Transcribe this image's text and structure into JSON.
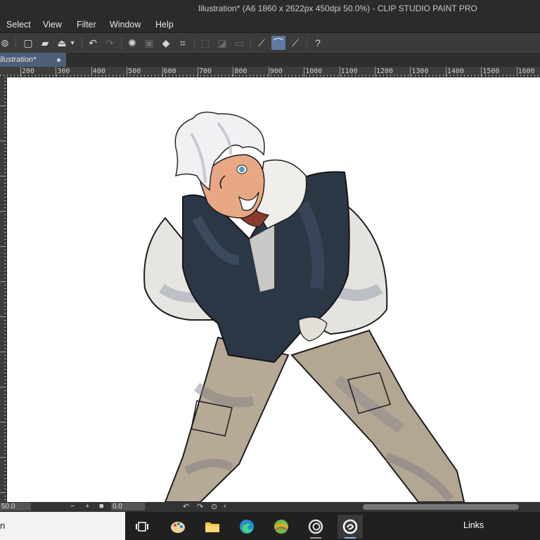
{
  "window": {
    "title": "Illustration* (A6 1860 x 2622px 450dpi 50.0%)  - CLIP STUDIO PAINT PRO"
  },
  "menu": [
    "Select",
    "View",
    "Filter",
    "Window",
    "Help"
  ],
  "tab": {
    "label": "llustration*"
  },
  "ruler": {
    "labels": [
      "200",
      "300",
      "400",
      "500",
      "600",
      "700",
      "800",
      "900",
      "1000",
      "1100",
      "1200",
      "1300",
      "1400",
      "1500",
      "1600"
    ]
  },
  "status": {
    "zoom": "50.0",
    "angle": "0.0"
  },
  "taskbar": {
    "search_text": "n",
    "links": "Links"
  },
  "colors": {
    "accent": "#5e7aa3",
    "tab": "#4e5e78",
    "jacket": "#2b3744",
    "hoodie": "#e9e7e2",
    "pants": "#b9ab97",
    "hair": "#f0f0f2"
  }
}
